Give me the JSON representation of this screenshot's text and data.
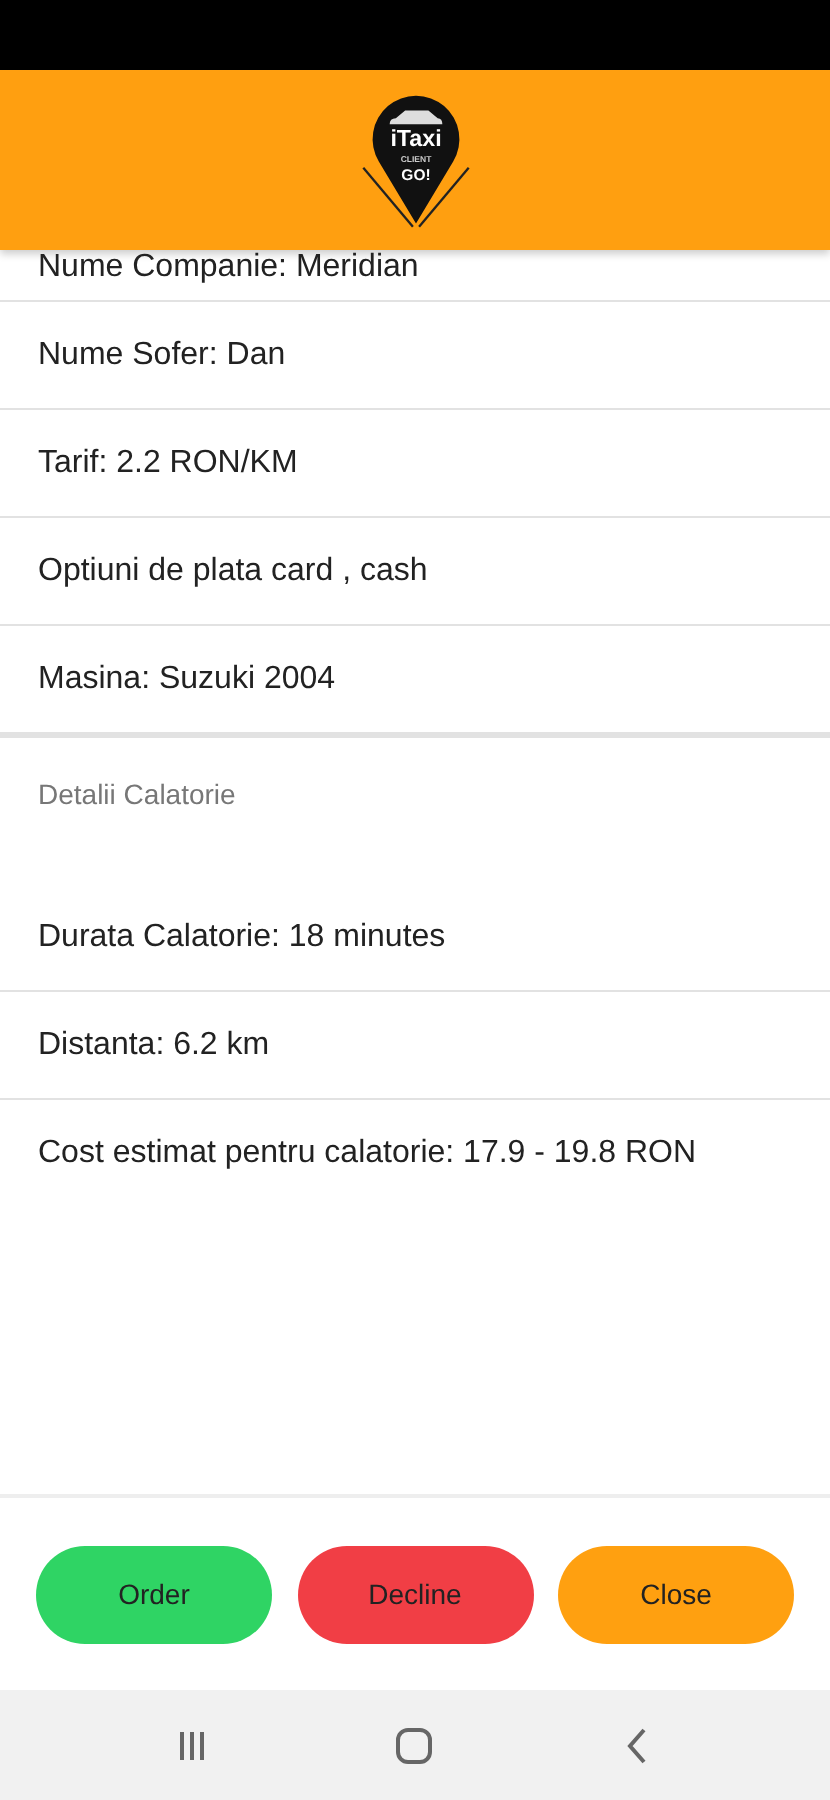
{
  "logo": {
    "title": "iTaxi",
    "subtitle": "CLIENT",
    "tagline": "GO!"
  },
  "driver_details": [
    "Nume Companie: Meridian",
    "Nume Sofer: Dan",
    "Tarif: 2.2 RON/KM",
    "Optiuni de plata card , cash",
    "Masina: Suzuki 2004"
  ],
  "trip_section": {
    "title": "Detalii Calatorie",
    "rows": [
      "Durata Calatorie: 18 minutes",
      "Distanta: 6.2 km",
      "Cost estimat pentru calatorie: 17.9 - 19.8 RON"
    ]
  },
  "buttons": [
    {
      "label": "Order",
      "kind": "order"
    },
    {
      "label": "Decline",
      "kind": "decline"
    },
    {
      "label": "Close",
      "kind": "close"
    }
  ]
}
